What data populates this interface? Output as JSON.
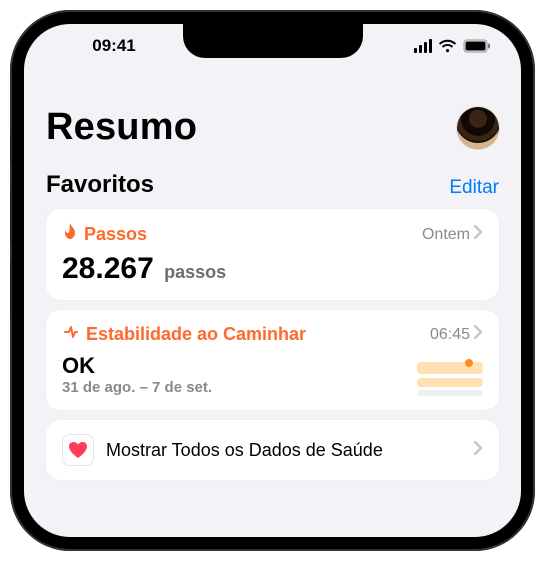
{
  "status": {
    "time": "09:41"
  },
  "header": {
    "title": "Resumo"
  },
  "favorites": {
    "section_title": "Favoritos",
    "edit_label": "Editar",
    "cards": {
      "steps": {
        "label": "Passos",
        "time_label": "Ontem",
        "value": "28.267",
        "unit": "passos"
      },
      "walking": {
        "label": "Estabilidade ao Caminhar",
        "time_label": "06:45",
        "status": "OK",
        "date_range": "31 de ago. – 7 de set."
      }
    },
    "show_all_label": "Mostrar Todos os Dados de Saúde"
  },
  "colors": {
    "accent_orange": "#ff6a2c",
    "link_blue": "#007aff"
  }
}
